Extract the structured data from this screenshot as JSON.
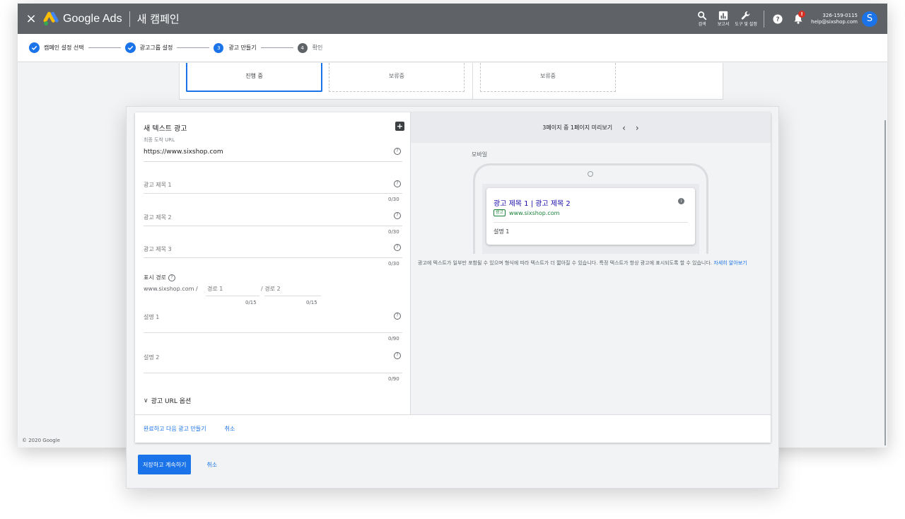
{
  "topbar": {
    "close_glyph": "×",
    "brand": "Google Ads",
    "campaign_title": "새 캠페인",
    "tools": [
      {
        "label": "검색",
        "icon": "search-icon"
      },
      {
        "label": "보고서",
        "icon": "reports-icon"
      },
      {
        "label": "도구 및 설정",
        "icon": "wrench-icon"
      }
    ],
    "help_icon": "help-icon",
    "notification_badge": "!",
    "account_id": "326-159-0115",
    "account_email": "help@sixshop.com",
    "avatar_letter": "S"
  },
  "stepper": {
    "steps": [
      {
        "label": "캠페인 설정 선택",
        "state": "done"
      },
      {
        "label": "광고그룹 설정",
        "state": "done"
      },
      {
        "label": "광고 만들기",
        "number": "3",
        "state": "current"
      },
      {
        "label": "확인",
        "number": "4",
        "state": "upcoming"
      }
    ]
  },
  "status_cards": [
    "진행 중",
    "보류중",
    "보류중"
  ],
  "footer": {
    "copyright": "© 2020 Google"
  },
  "form": {
    "title": "새 텍스트 광고",
    "final_url_label": "최종 도착 URL",
    "final_url_value": "https://www.sixshop.com",
    "headline1_placeholder": "광고 제목 1",
    "headline2_placeholder": "광고 제목 2",
    "headline3_placeholder": "광고 제목 3",
    "headline_counter": "0/30",
    "display_path_label": "표시 경로",
    "display_path_domain": "www.sixshop.com /",
    "path1_placeholder": "경로 1",
    "path2_placeholder": "/ 경로 2",
    "path_counter": "0/15",
    "description1_placeholder": "설명 1",
    "description2_placeholder": "설명 2",
    "description_counter": "0/90",
    "url_options_label": "광고 URL 옵션"
  },
  "editor_footer": {
    "done_and_next": "완료하고 다음 광고 만들기",
    "cancel": "취소"
  },
  "preview": {
    "header": "3페이지 중 1페이지 미리보기",
    "prev_glyph": "‹",
    "next_glyph": "›",
    "device_label": "모바일",
    "ad_headline": "광고 제목 1 | 광고 제목 2",
    "ad_badge": "광고",
    "ad_url": "www.sixshop.com",
    "ad_description": "설명 1",
    "note": "광고에 텍스트가 일부만 포함될 수 있으며 형식에 따라 텍스트가 더 짧아질 수 있습니다. 특정 텍스트가 항상 광고에 표시되도록 할 수 있습니다.",
    "learn_more": "자세히 알아보기"
  },
  "dialog_actions": {
    "save_continue": "저장하고 계속하기",
    "cancel": "취소"
  },
  "colors": {
    "topbar": "#5f6368",
    "primary": "#1a73e8",
    "ad_headline": "#1a0dab",
    "ad_url": "#188038",
    "badge_red": "#d93025"
  }
}
